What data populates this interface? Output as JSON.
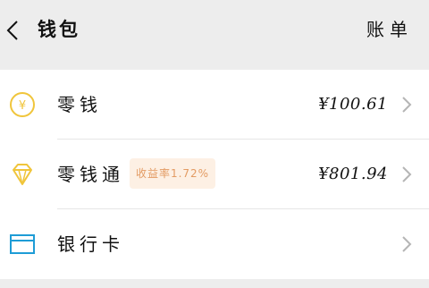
{
  "header": {
    "title": "钱包",
    "bill_label": "账单"
  },
  "wallet": {
    "items": [
      {
        "label": "零钱",
        "amount": "¥100.61",
        "icon": "yuan-coin-icon"
      },
      {
        "label": "零钱通",
        "amount": "¥801.94",
        "icon": "diamond-icon",
        "badge": "收益率1.72%"
      },
      {
        "label": "银行卡",
        "amount": "",
        "icon": "bank-card-icon"
      }
    ]
  },
  "colors": {
    "page_background": "#ededed",
    "card_background": "#ffffff",
    "icon_gold": "#f0c53b",
    "icon_blue": "#1e9cd6",
    "badge_background": "#fdf0e4",
    "badge_text": "#e39b63"
  }
}
